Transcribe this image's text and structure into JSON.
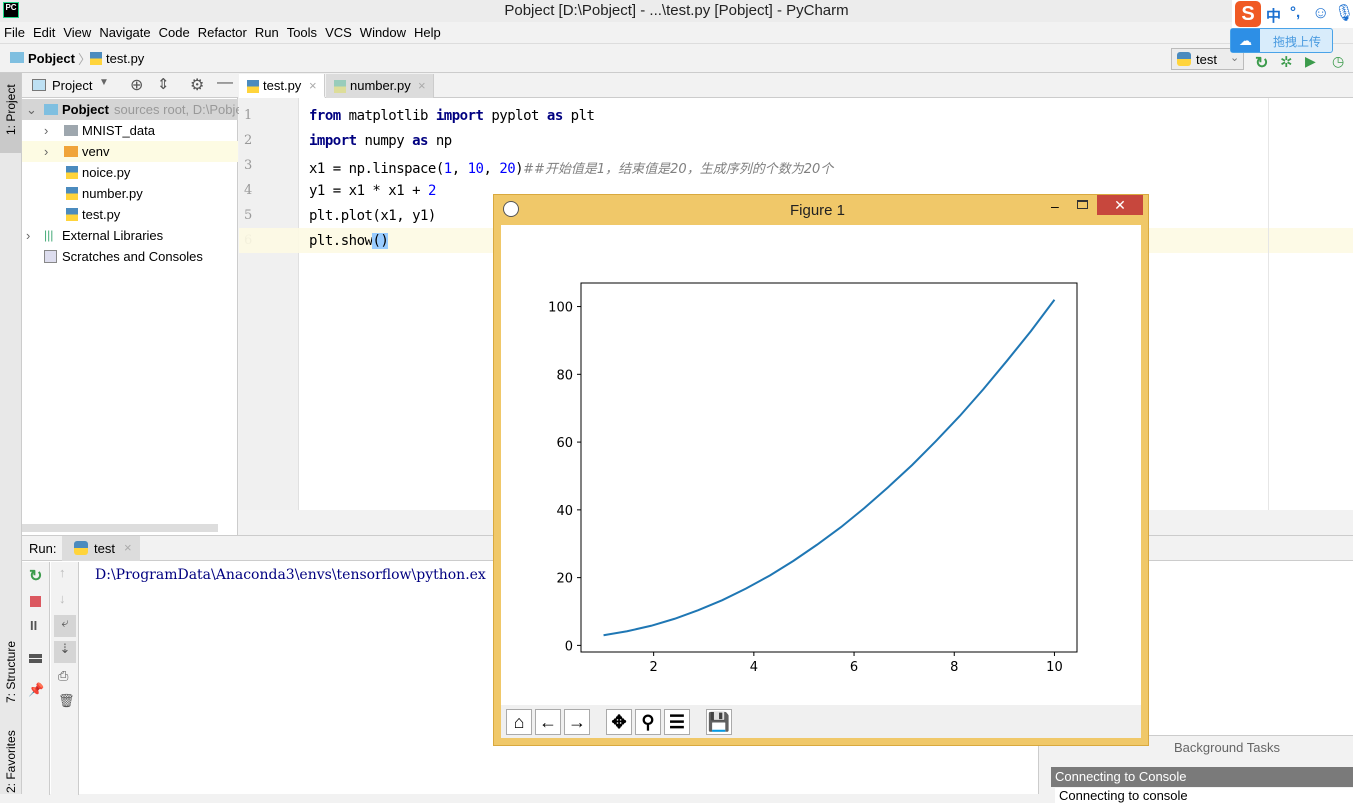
{
  "window": {
    "title": "Pobject [D:\\Pobject] - ...\\test.py [Pobject] - PyCharm",
    "app_icon": "PC"
  },
  "menu": [
    "File",
    "Edit",
    "View",
    "Navigate",
    "Code",
    "Refactor",
    "Run",
    "Tools",
    "VCS",
    "Window",
    "Help"
  ],
  "breadcrumb": {
    "project": "Pobject",
    "file": "test.py"
  },
  "run_config": {
    "label": "test"
  },
  "ime": {
    "lang": "中",
    "punct": "°,",
    "upload": "拖拽上传"
  },
  "left_tools": {
    "project": "1: Project",
    "structure": "7: Structure",
    "favorites": "2: Favorites"
  },
  "project_panel": {
    "title": "Project",
    "root": {
      "name": "Pobject",
      "hint": "sources root, D:\\Pobject"
    },
    "items": [
      {
        "name": "MNIST_data",
        "type": "folder"
      },
      {
        "name": "venv",
        "type": "folder-orange"
      },
      {
        "name": "noice.py",
        "type": "python-file"
      },
      {
        "name": "number.py",
        "type": "python-file"
      },
      {
        "name": "test.py",
        "type": "python-file"
      }
    ],
    "external": "External Libraries",
    "scratches": "Scratches and Consoles"
  },
  "editor": {
    "tabs": [
      {
        "label": "test.py",
        "active": true
      },
      {
        "label": "number.py",
        "active": false
      }
    ],
    "lines": [
      "1",
      "2",
      "3",
      "4",
      "5",
      "6"
    ],
    "code": {
      "l1": [
        "from",
        " matplotlib ",
        "import",
        " pyplot ",
        "as",
        " plt"
      ],
      "l2": [
        "import",
        " numpy ",
        "as",
        " np"
      ],
      "l3": [
        "x1 = np.linspace(",
        "1",
        ", ",
        "10",
        ", ",
        "20",
        ")",
        "##开始值是1，结束值是20，生成序列的个数为20个"
      ],
      "l4": [
        "y1 = x1 * x1 + ",
        "2"
      ],
      "l5": "plt.plot(x1, y1)",
      "l6": [
        "plt.show",
        "()"
      ]
    }
  },
  "run": {
    "label": "Run:",
    "tab": "test",
    "output": "D:\\ProgramData\\Anaconda3\\envs\\tensorflow\\python.ex"
  },
  "background_tasks": {
    "title": "Background Tasks",
    "task": "Connecting to Console",
    "detail": "Connecting to console"
  },
  "figure": {
    "title": "Figure 1",
    "toolbar": [
      "home",
      "back",
      "forward",
      "pan",
      "zoom",
      "configure-subplots",
      "save"
    ],
    "line_color": "#1f77b4"
  },
  "chart_data": {
    "type": "line",
    "title": "",
    "xlabel": "",
    "ylabel": "",
    "xlim": [
      0.55,
      10.45
    ],
    "ylim": [
      -1.95,
      106.95
    ],
    "xticks": [
      2,
      4,
      6,
      8,
      10
    ],
    "yticks": [
      0,
      20,
      40,
      60,
      80,
      100
    ],
    "grid": false,
    "x": [
      1,
      1.47,
      1.95,
      2.42,
      2.89,
      3.37,
      3.84,
      4.32,
      4.79,
      5.26,
      5.74,
      6.21,
      6.68,
      7.16,
      7.63,
      8.11,
      8.58,
      9.05,
      9.53,
      10
    ],
    "series": [
      {
        "values": [
          3,
          4.17,
          5.79,
          7.86,
          10.38,
          13.35,
          16.76,
          20.63,
          24.94,
          29.7,
          34.91,
          40.57,
          46.68,
          53.24,
          60.24,
          67.7,
          75.6,
          83.95,
          92.75,
          102
        ]
      }
    ]
  }
}
